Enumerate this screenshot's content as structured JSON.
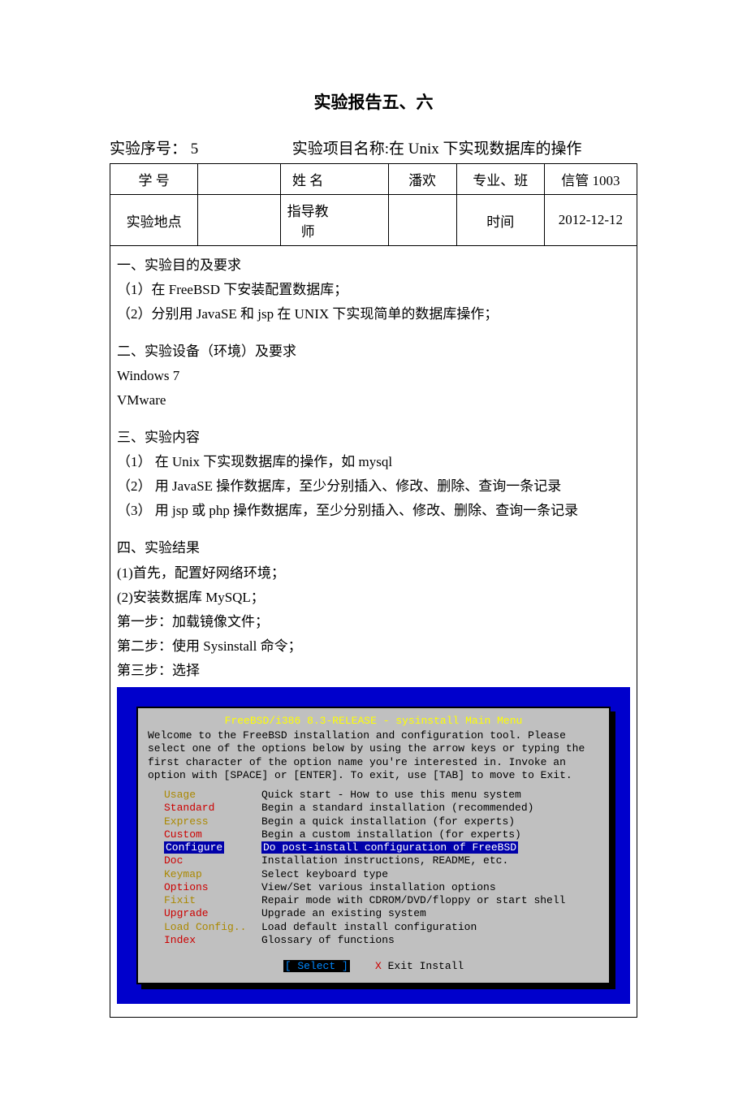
{
  "title": "实验报告五、六",
  "subtitle_left": "实验序号：  5",
  "subtitle_right": "实验项目名称:在 Unix 下实现数据库的操作",
  "table": {
    "r1": {
      "c1": "学    号",
      "c2": "",
      "c3": "姓    名",
      "c4": "潘欢",
      "c5": "专业、班",
      "c6": "信管 1003"
    },
    "r2": {
      "c1": "实验地点",
      "c2": "",
      "c3": "指导教师",
      "c4": "",
      "c5": "时间",
      "c6": "2012-12-12"
    }
  },
  "sec1_h": "一、实验目的及要求",
  "sec1_1": "（1）在 FreeBSD 下安装配置数据库；",
  "sec1_2": "（2）分别用 JavaSE 和 jsp 在 UNIX 下实现简单的数据库操作；",
  "sec2_h": "二、实验设备（环境）及要求",
  "sec2_1": "Windows 7",
  "sec2_2": "VMware",
  "sec3_h": "三、实验内容",
  "sec3_1": "（1）  在 Unix 下实现数据库的操作，如 mysql",
  "sec3_2": "（2）  用 JavaSE 操作数据库，至少分别插入、修改、删除、查询一条记录",
  "sec3_3": "（3）  用 jsp 或 php 操作数据库，至少分别插入、修改、删除、查询一条记录",
  "sec4_h": "四、实验结果",
  "sec4_1": "(1)首先，配置好网络环境；",
  "sec4_2": "(2)安装数据库 MySQL；",
  "sec4_3": "第一步：加载镜像文件；",
  "sec4_4": "第二步：使用 Sysinstall 命令；",
  "sec4_5": "第三步：选择",
  "term": {
    "title": "FreeBSD/i386 8.3-RELEASE - sysinstall Main Menu",
    "intro": "Welcome to the FreeBSD installation and configuration tool.  Please select one of the options below by using the arrow keys or typing the first character of the option name you're interested in.  Invoke an option with [SPACE] or [ENTER].  To exit, use [TAB] to move to Exit.",
    "menu": [
      {
        "name": "Usage",
        "desc": "Quick start - How to use this menu system",
        "style": "yel"
      },
      {
        "name": "Standard",
        "desc": "Begin a standard installation (recommended)",
        "style": "red"
      },
      {
        "name": "Express",
        "desc": "Begin a quick installation (for experts)",
        "style": "yel"
      },
      {
        "name": "Custom",
        "desc": "Begin a custom installation (for experts)",
        "style": "red"
      },
      {
        "name": "Configure",
        "desc": "Do post-install configuration of FreeBSD",
        "style": "sel"
      },
      {
        "name": "Doc",
        "desc": "Installation instructions, README, etc.",
        "style": "red"
      },
      {
        "name": "Keymap",
        "desc": "Select keyboard type",
        "style": "yel"
      },
      {
        "name": "Options",
        "desc": "View/Set various installation options",
        "style": "red"
      },
      {
        "name": "Fixit",
        "desc": "Repair mode with CDROM/DVD/floppy or start shell",
        "style": "yel"
      },
      {
        "name": "Upgrade",
        "desc": "Upgrade an existing system",
        "style": "red"
      },
      {
        "name": "Load Config..",
        "desc": "Load default install configuration",
        "style": "yel"
      },
      {
        "name": "Index",
        "desc": "Glossary of functions",
        "style": "red"
      }
    ],
    "btn_select": "[ Select ]",
    "btn_exit": "Exit Install",
    "btn_x": "X"
  }
}
